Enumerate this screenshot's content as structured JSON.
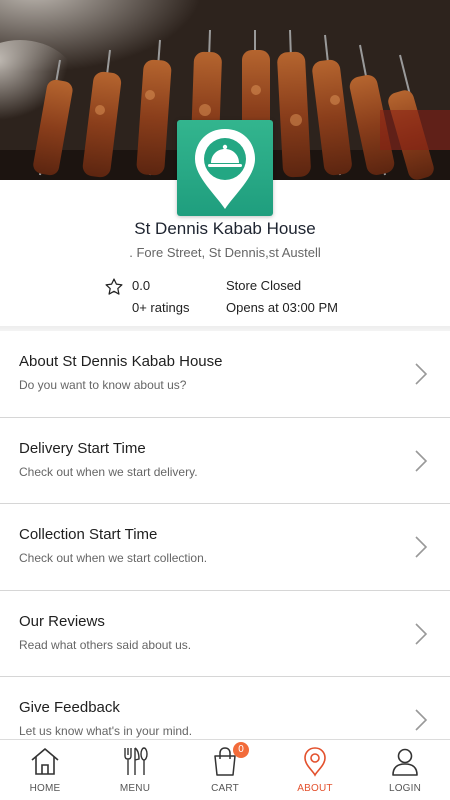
{
  "store": {
    "name": "St Dennis Kabab House",
    "address": ". Fore Street, St Dennis,st Austell",
    "rating": "0.0",
    "ratings_count": "0+ ratings",
    "status": "Store Closed",
    "opens": "Opens at 03:00 PM"
  },
  "menu": [
    {
      "title": "About St Dennis Kabab House",
      "subtitle": "Do you want to know about us?"
    },
    {
      "title": "Delivery Start Time",
      "subtitle": "Check out when we start delivery."
    },
    {
      "title": "Collection Start Time",
      "subtitle": "Check out when we start collection."
    },
    {
      "title": "Our Reviews",
      "subtitle": "Read what others said about us."
    },
    {
      "title": "Give Feedback",
      "subtitle": "Let us know what's in your mind."
    }
  ],
  "tabs": {
    "home": "HOME",
    "menu": "MENU",
    "cart": "CART",
    "cart_count": "0",
    "about": "ABOUT",
    "login": "LOGIN"
  },
  "active_tab": "about",
  "colors": {
    "accent": "#e3512d",
    "logo_green": "#27a884",
    "badge": "#f26b3a"
  },
  "icons": [
    "star-icon",
    "chevron-right-icon",
    "home-icon",
    "cutlery-icon",
    "shopping-bag-icon",
    "location-pin-icon",
    "user-icon",
    "cloche-icon"
  ]
}
